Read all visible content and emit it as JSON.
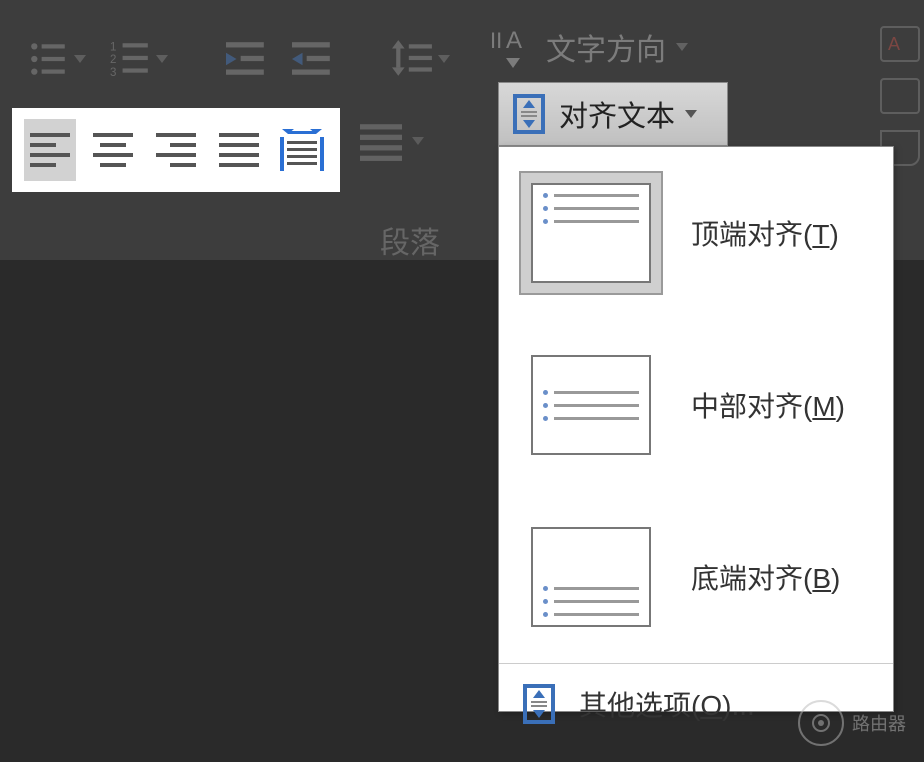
{
  "ribbon": {
    "section_label": "段落",
    "text_direction_label": "文字方向"
  },
  "align_text_button": {
    "label": "对齐文本"
  },
  "menu": {
    "top": "顶端对齐",
    "top_hot": "T",
    "middle": "中部对齐",
    "middle_hot": "M",
    "bottom": "底端对齐",
    "bottom_hot": "B",
    "more": "其他选项",
    "more_hot": "O",
    "more_suffix": "..."
  },
  "watermark": {
    "text": "路由器"
  }
}
